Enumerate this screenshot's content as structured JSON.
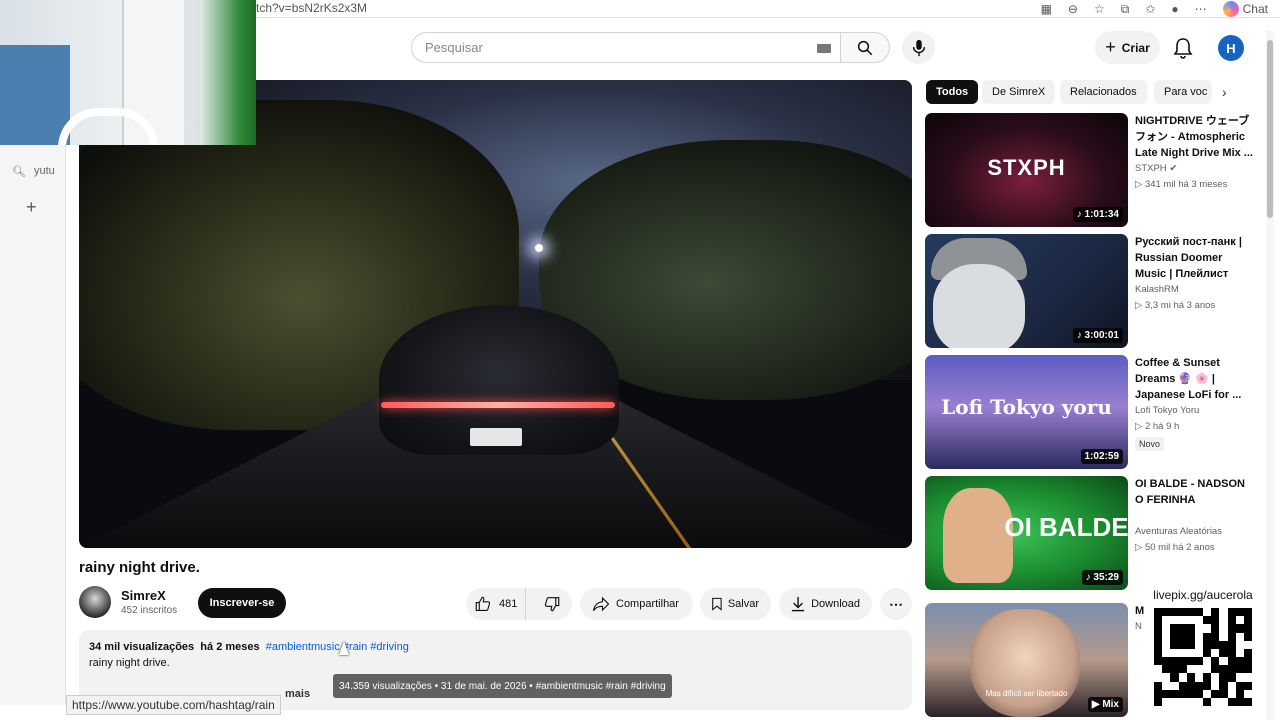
{
  "browser": {
    "url": "tch?v=bsN2rKs2x3M",
    "chat_label": "Chat"
  },
  "sidebar": {
    "search_text": "yutu"
  },
  "header": {
    "search_placeholder": "Pesquisar",
    "create_label": "Criar",
    "avatar_letter": "H"
  },
  "video": {
    "title": "rainy night drive.",
    "channel": "SimreX",
    "subscribers": "452 inscritos",
    "subscribe_label": "Inscrever-se",
    "likes": "481",
    "share_label": "Compartilhar",
    "save_label": "Salvar",
    "download_label": "Download",
    "more_label": "⋯",
    "desc_views": "34 mil visualizações",
    "desc_age": "há 2 meses",
    "desc_tags": "#ambientmusic #rain #driving",
    "desc_text": "rainy night drive.",
    "desc_more": "mais",
    "tooltip": "34.359 visualizações • 31 de mai. de 2026 • #ambientmusic #rain #driving"
  },
  "status_url": "https://www.youtube.com/hashtag/rain",
  "chips": [
    "Todos",
    "De SimreX",
    "Relacionados",
    "Para voc"
  ],
  "recommendations": [
    {
      "title": "NIGHTDRIVE ウェーブフォン - Atmospheric Late Night Drive Mix ...",
      "channel": "STXPH",
      "meta": "▷ 341 mil  há 3 meses",
      "duration": "♪ 1:01:34",
      "thumb_text": "STXPH",
      "badge": ""
    },
    {
      "title": "Русский пост-панк | Russian Doomer Music | Плейлист дл...",
      "channel": "KalashRM",
      "meta": "▷ 3,3 mi  há 3 anos",
      "duration": "♪ 3:00:01",
      "thumb_text": "",
      "badge": ""
    },
    {
      "title": "Coffee & Sunset Dreams 🔮 🌸 | Japanese LoFi for ...",
      "channel": "Lofi Tokyo Yoru",
      "meta": "▷ 2  há 9 h",
      "duration": "1:02:59",
      "thumb_text": "Lofi Tokyo yoru",
      "badge": "Novo"
    },
    {
      "title": "OI BALDE - NADSON O FERINHA",
      "channel": "Aventuras Aleatórias",
      "meta": "▷ 50 mil  há 2 anos",
      "duration": "♪ 35:29",
      "thumb_text": "OI BALDE",
      "badge": ""
    },
    {
      "title": "M",
      "channel": "N",
      "meta": "",
      "duration": "▶ Mix",
      "thumb_text": "Mas difícil ser libertado",
      "badge": ""
    }
  ],
  "overlay": {
    "livepix": "livepix.gg/aucerola"
  },
  "colors": {
    "accent": "#065fd4",
    "avatar": "#1565c0",
    "subscribe": "#0f0f0f"
  }
}
